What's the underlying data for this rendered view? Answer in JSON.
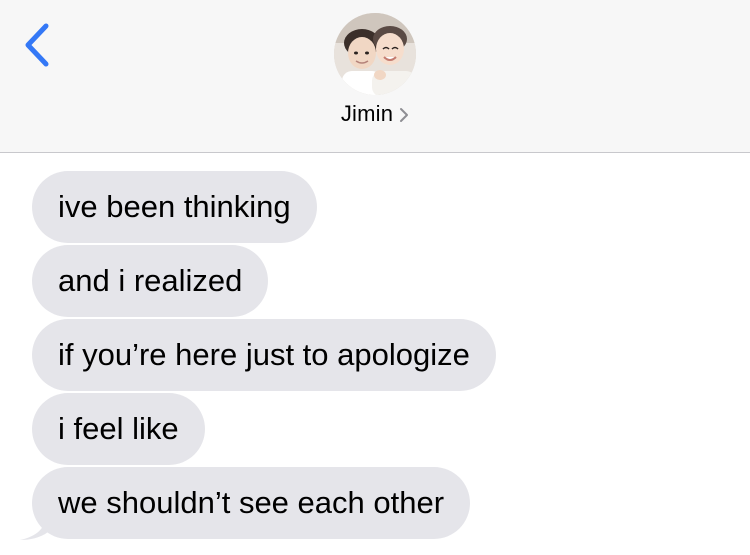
{
  "header": {
    "back_icon": "chevron-left-icon",
    "contact_name": "Jimin",
    "contact_chevron_icon": "chevron-right-icon",
    "avatar_icon": "contact-photo",
    "accent_color": "#3478f6"
  },
  "messages": [
    {
      "text": "ive been thinking",
      "direction": "received"
    },
    {
      "text": "and i realized",
      "direction": "received"
    },
    {
      "text": "if you’re here just to apologize",
      "direction": "received"
    },
    {
      "text": "i feel like",
      "direction": "received"
    },
    {
      "text": "we shouldn’t see each other",
      "direction": "received"
    }
  ],
  "colors": {
    "received_bubble": "#e5e5ea",
    "header_background": "#f7f7f7"
  }
}
